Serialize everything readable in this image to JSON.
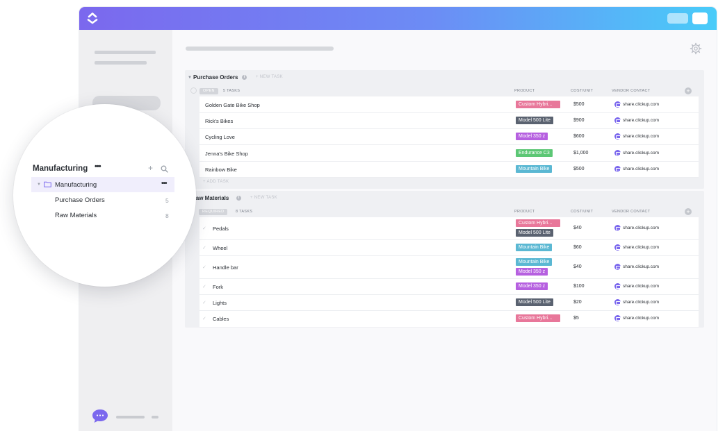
{
  "colors": {
    "brand_gradient_start": "#7b68ee",
    "brand_gradient_end": "#49ccf9",
    "tag_custom_hybrid": "#e8779a",
    "tag_model_500_lite": "#5a6270",
    "tag_model_350_z": "#b660e0",
    "tag_endurance_c3": "#5cc775",
    "tag_mountain_bike": "#5bb8d3",
    "vendor_icon": "#7b68ee"
  },
  "icons": {
    "logo": "clickup-logo-icon",
    "settings": "gear-icon",
    "chat": "chat-bubble-icon",
    "folder": "folder-icon",
    "search": "search-icon",
    "add": "plus-icon"
  },
  "sidebar_popout": {
    "space_name": "Manufacturing",
    "space_more": "•••",
    "add_icon_label": "+",
    "folder_name": "Manufacturing",
    "folder_more": "•••",
    "lists": [
      {
        "name": "Purchase Orders",
        "count": "5"
      },
      {
        "name": "Raw Materials",
        "count": "8"
      }
    ]
  },
  "sections": [
    {
      "title": "Purchase Orders",
      "info": "i",
      "new_task": "+ NEW TASK",
      "status": "OPEN",
      "task_count": "5 TASKS",
      "columns": {
        "product": "PRODUCT",
        "cost": "COST/UNIT",
        "vendor": "VENDOR CONTACT"
      },
      "add_task": "+ ADD TASK",
      "rows": [
        {
          "name": "Golden Gate Bike Shop",
          "tags": [
            {
              "label": "Custom Hybri...",
              "color": "#e8779a"
            }
          ],
          "cost": "$500",
          "vendor": "share.clickup.com"
        },
        {
          "name": "Rick's Bikes",
          "tags": [
            {
              "label": "Model 500 Lite",
              "color": "#5a6270"
            }
          ],
          "cost": "$900",
          "vendor": "share.clickup.com"
        },
        {
          "name": "Cycling Love",
          "tags": [
            {
              "label": "Model 350 z",
              "color": "#b660e0"
            }
          ],
          "cost": "$600",
          "vendor": "share.clickup.com"
        },
        {
          "name": "Jenna's Bike Shop",
          "tags": [
            {
              "label": "Endurance C3",
              "color": "#5cc775"
            }
          ],
          "cost": "$1,000",
          "vendor": "share.clickup.com"
        },
        {
          "name": "Rainbow Bike",
          "tags": [
            {
              "label": "Mountain Bike",
              "color": "#5bb8d3"
            }
          ],
          "cost": "$500",
          "vendor": "share.clickup.com"
        }
      ]
    },
    {
      "title": "Raw Materials",
      "info": "i",
      "new_task": "+ NEW TASK",
      "status": "REQUIRED",
      "task_count": "8 TASKS",
      "columns": {
        "product": "PRODUCT",
        "cost": "COST/UNIT",
        "vendor": "VENDOR CONTACT"
      },
      "rows": [
        {
          "name": "Pedals",
          "tags": [
            {
              "label": "Custom Hybri...",
              "color": "#e8779a"
            },
            {
              "label": "Model 500 Lite",
              "color": "#5a6270"
            }
          ],
          "cost": "$40",
          "vendor": "share.clickup.com"
        },
        {
          "name": "Wheel",
          "tags": [
            {
              "label": "Mountain Bike",
              "color": "#5bb8d3"
            }
          ],
          "cost": "$60",
          "vendor": "share.clickup.com"
        },
        {
          "name": "Handle bar",
          "tags": [
            {
              "label": "Mountain Bike",
              "color": "#5bb8d3"
            },
            {
              "label": "Model 350 z",
              "color": "#b660e0"
            }
          ],
          "cost": "$40",
          "vendor": "share.clickup.com"
        },
        {
          "name": "Fork",
          "tags": [
            {
              "label": "Model 350 z",
              "color": "#b660e0"
            }
          ],
          "cost": "$100",
          "vendor": "share.clickup.com"
        },
        {
          "name": "Lights",
          "tags": [
            {
              "label": "Model 500 Lite",
              "color": "#5a6270"
            }
          ],
          "cost": "$20",
          "vendor": "share.clickup.com"
        },
        {
          "name": "Cables",
          "tags": [
            {
              "label": "Custom Hybri...",
              "color": "#e8779a"
            }
          ],
          "cost": "$5",
          "vendor": "share.clickup.com"
        }
      ]
    }
  ]
}
